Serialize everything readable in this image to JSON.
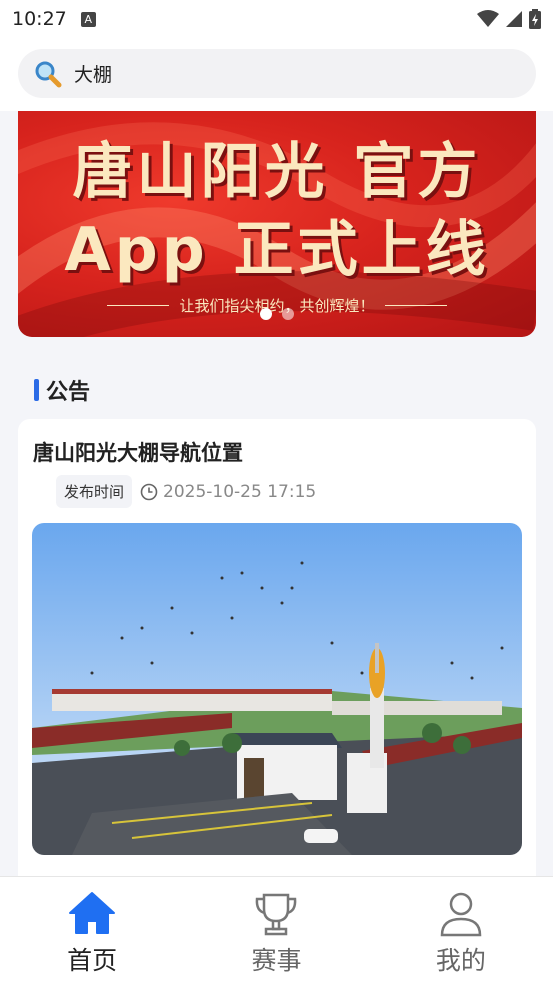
{
  "status_bar": {
    "time": "10:27",
    "a_badge": "A"
  },
  "search": {
    "value": "大棚"
  },
  "banner": {
    "line1": "唐山阳光 官方",
    "line2": "App 正式上线",
    "slogan": "让我们指尖相约，共创辉煌！",
    "slide_count": 2,
    "active_slide": 1
  },
  "section": {
    "title": "公告"
  },
  "card": {
    "title": "唐山阳光大棚导航位置",
    "badge": "发布时间",
    "time": "2025-10-25 17:15"
  },
  "tabbar": {
    "items": [
      {
        "label": "首页",
        "icon": "home-icon",
        "active": true
      },
      {
        "label": "赛事",
        "icon": "trophy-icon",
        "active": false
      },
      {
        "label": "我的",
        "icon": "user-icon",
        "active": false
      }
    ]
  },
  "colors": {
    "accent": "#2b6be6",
    "banner_red": "#d7231d",
    "banner_text": "#fbe8bf",
    "tab_active": "#1f6ff2"
  }
}
